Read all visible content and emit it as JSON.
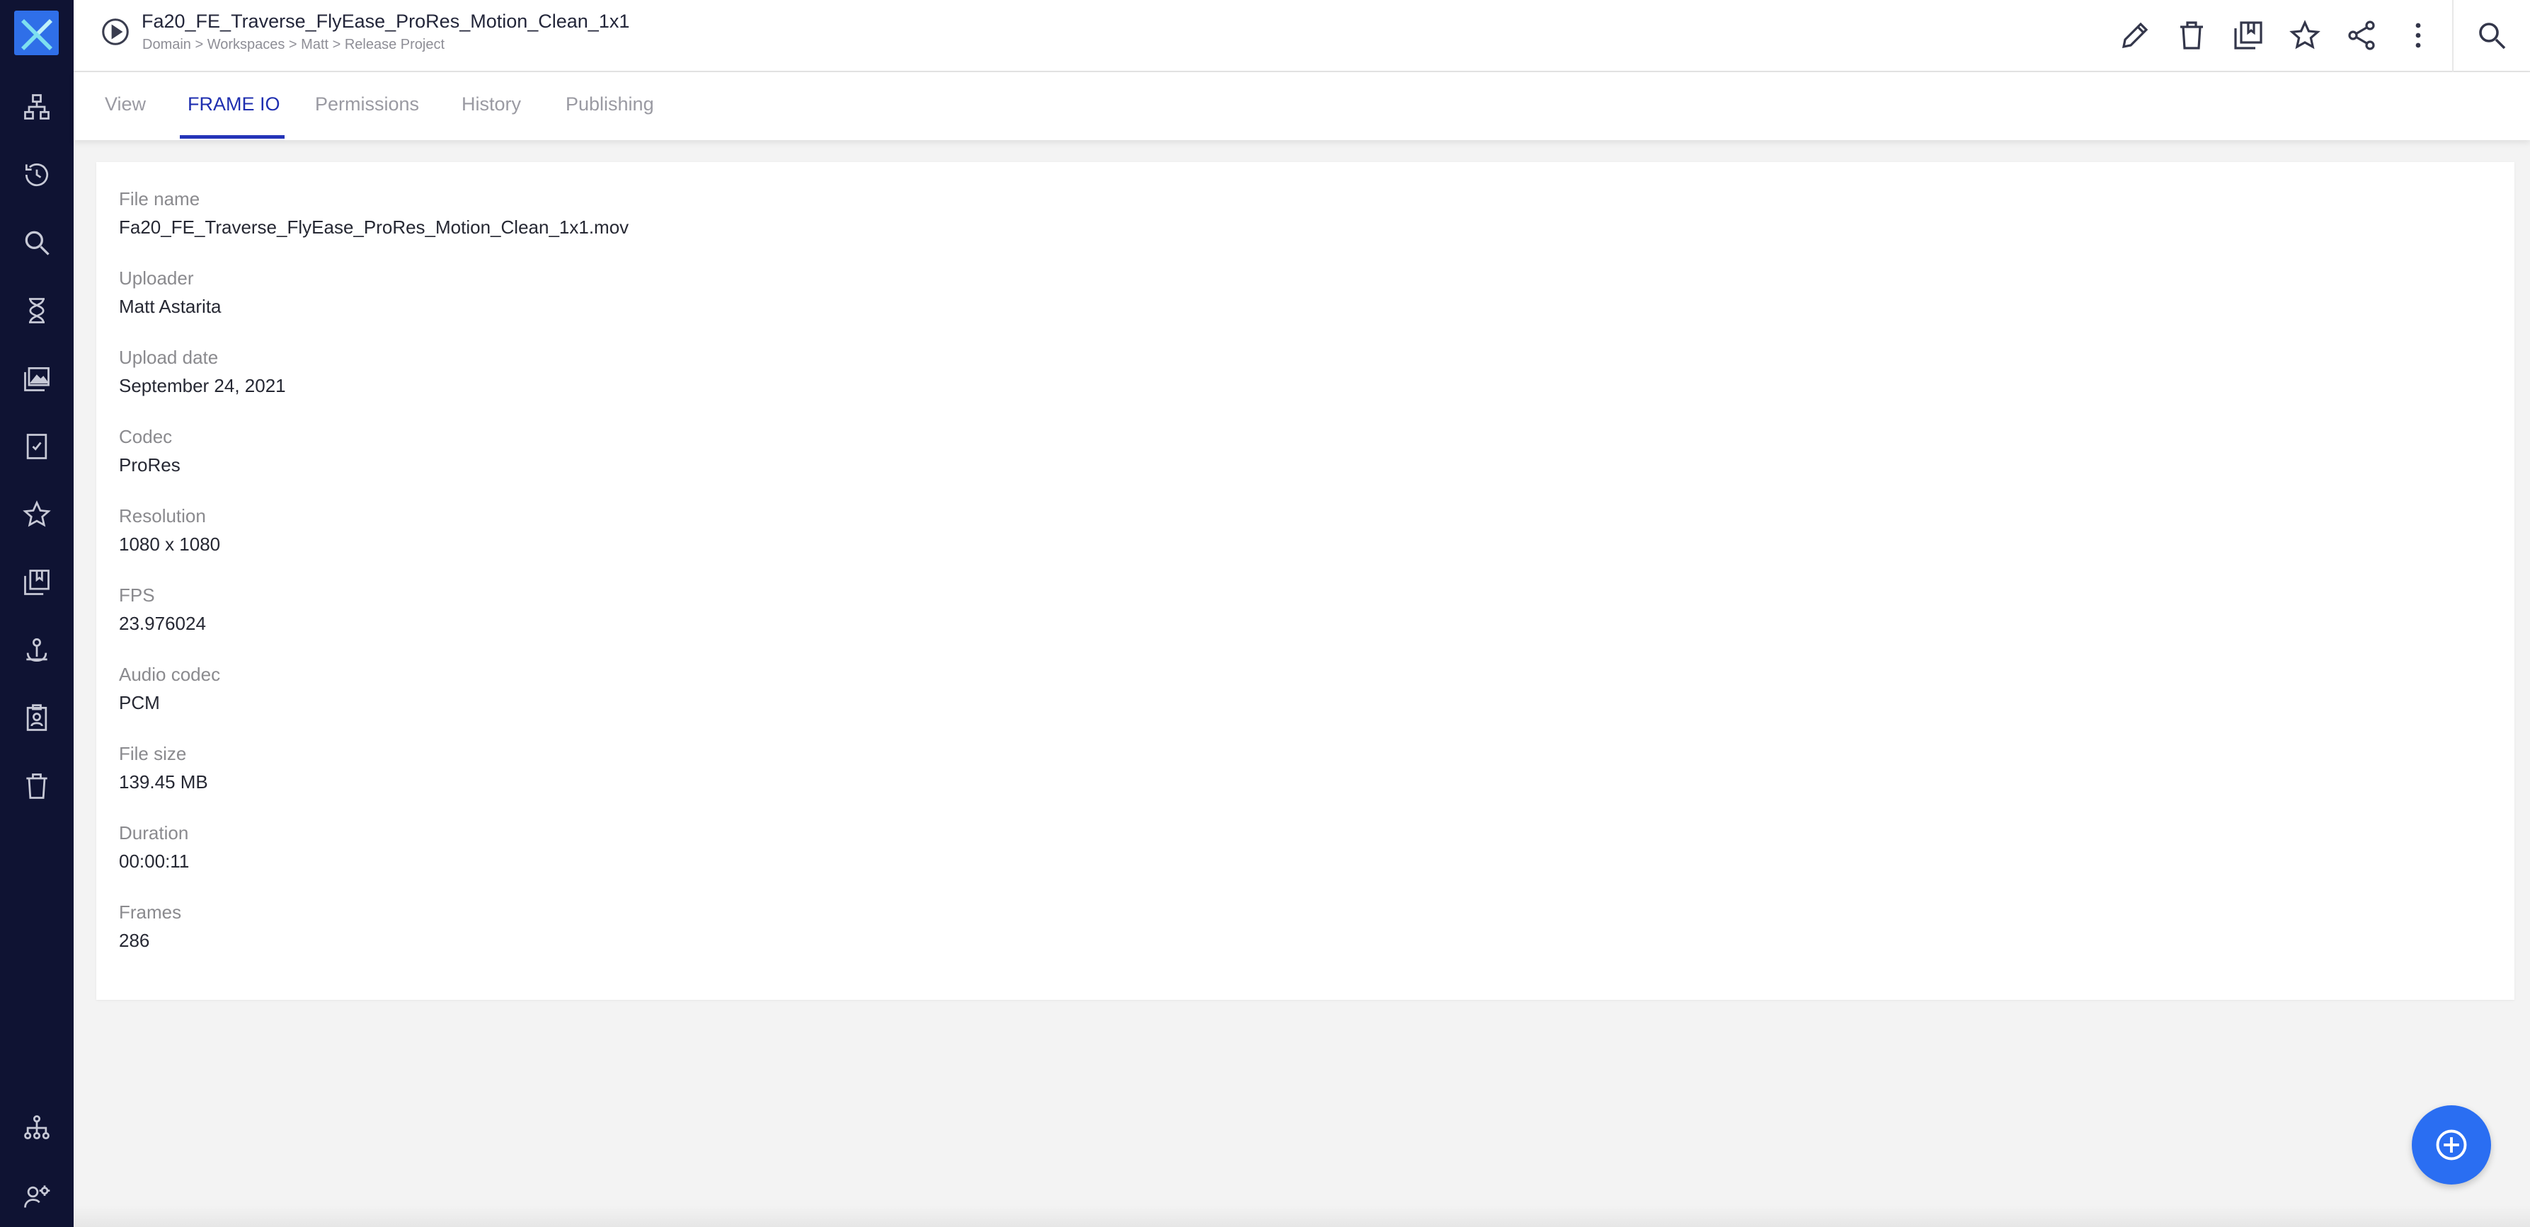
{
  "header": {
    "title": "Fa20_FE_Traverse_FlyEase_ProRes_Motion_Clean_1x1",
    "breadcrumb": "Domain > Workspaces > Matt > Release Project"
  },
  "tabs": [
    {
      "label": "View"
    },
    {
      "label": "FRAME IO"
    },
    {
      "label": "Permissions"
    },
    {
      "label": "History"
    },
    {
      "label": "Publishing"
    }
  ],
  "fields": [
    {
      "label": "File name",
      "value": "Fa20_FE_Traverse_FlyEase_ProRes_Motion_Clean_1x1.mov"
    },
    {
      "label": "Uploader",
      "value": "Matt Astarita"
    },
    {
      "label": "Upload date",
      "value": "September 24, 2021"
    },
    {
      "label": "Codec",
      "value": "ProRes"
    },
    {
      "label": "Resolution",
      "value": "1080 x 1080"
    },
    {
      "label": "FPS",
      "value": "23.976024"
    },
    {
      "label": "Audio codec",
      "value": "PCM"
    },
    {
      "label": "File size",
      "value": "139.45 MB"
    },
    {
      "label": "Duration",
      "value": "00:00:11"
    },
    {
      "label": "Frames",
      "value": "286"
    }
  ],
  "colors": {
    "sidebar": "#0f1333",
    "accent": "#2a6ef2",
    "active_tab": "#1f2fb0"
  },
  "sidebar_icons": [
    "hierarchy-icon",
    "history-icon",
    "search-icon",
    "hourglass-icon",
    "gallery-icon",
    "checklist-icon",
    "star-icon",
    "collections-icon",
    "anchor-icon",
    "contact-card-icon",
    "trash-icon",
    "org-chart-icon",
    "user-settings-icon"
  ],
  "header_icons": [
    "edit-icon",
    "delete-icon",
    "collection-add-icon",
    "favorite-icon",
    "share-icon",
    "more-icon",
    "search-icon"
  ]
}
